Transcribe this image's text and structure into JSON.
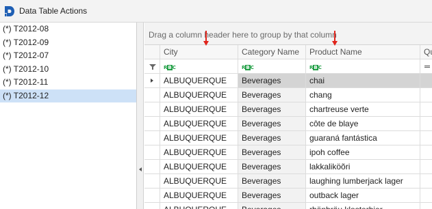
{
  "window": {
    "title": "Data Table Actions"
  },
  "left_panel": {
    "items": [
      {
        "label": "(*) T2012-08"
      },
      {
        "label": "(*) T2012-09"
      },
      {
        "label": "(*) T2012-07"
      },
      {
        "label": "(*) T2012-10"
      },
      {
        "label": "(*) T2012-11"
      },
      {
        "label": "(*) T2012-12"
      }
    ],
    "selected_index": 5
  },
  "grid": {
    "group_panel_text": "Drag a column header here to group by that column",
    "columns": [
      {
        "label": "City"
      },
      {
        "label": "Category Name"
      },
      {
        "label": "Product Name"
      },
      {
        "label": "Qu"
      }
    ],
    "filter_icon_text": {
      "a": "R",
      "b": "B",
      "c": "C"
    },
    "rows": [
      {
        "city": "ALBUQUERQUE",
        "category": "Beverages",
        "product": "chai"
      },
      {
        "city": "ALBUQUERQUE",
        "category": "Beverages",
        "product": "chang"
      },
      {
        "city": "ALBUQUERQUE",
        "category": "Beverages",
        "product": "chartreuse verte"
      },
      {
        "city": "ALBUQUERQUE",
        "category": "Beverages",
        "product": "côte de blaye"
      },
      {
        "city": "ALBUQUERQUE",
        "category": "Beverages",
        "product": "guaraná fantástica"
      },
      {
        "city": "ALBUQUERQUE",
        "category": "Beverages",
        "product": "ipoh coffee"
      },
      {
        "city": "ALBUQUERQUE",
        "category": "Beverages",
        "product": "lakkaliköõri"
      },
      {
        "city": "ALBUQUERQUE",
        "category": "Beverages",
        "product": "laughing lumberjack lager"
      },
      {
        "city": "ALBUQUERQUE",
        "category": "Beverages",
        "product": "outback lager"
      },
      {
        "city": "ALBUQUERQUE",
        "category": "Beverages",
        "product": "rhönbräu klosterbier"
      }
    ],
    "focused_row": 0
  },
  "colors": {
    "app_icon": "#1f5fb4",
    "selected_item": "#cde1f7",
    "annotation_arrow": "#e0241b",
    "filter_badge": "#1f9e44"
  }
}
